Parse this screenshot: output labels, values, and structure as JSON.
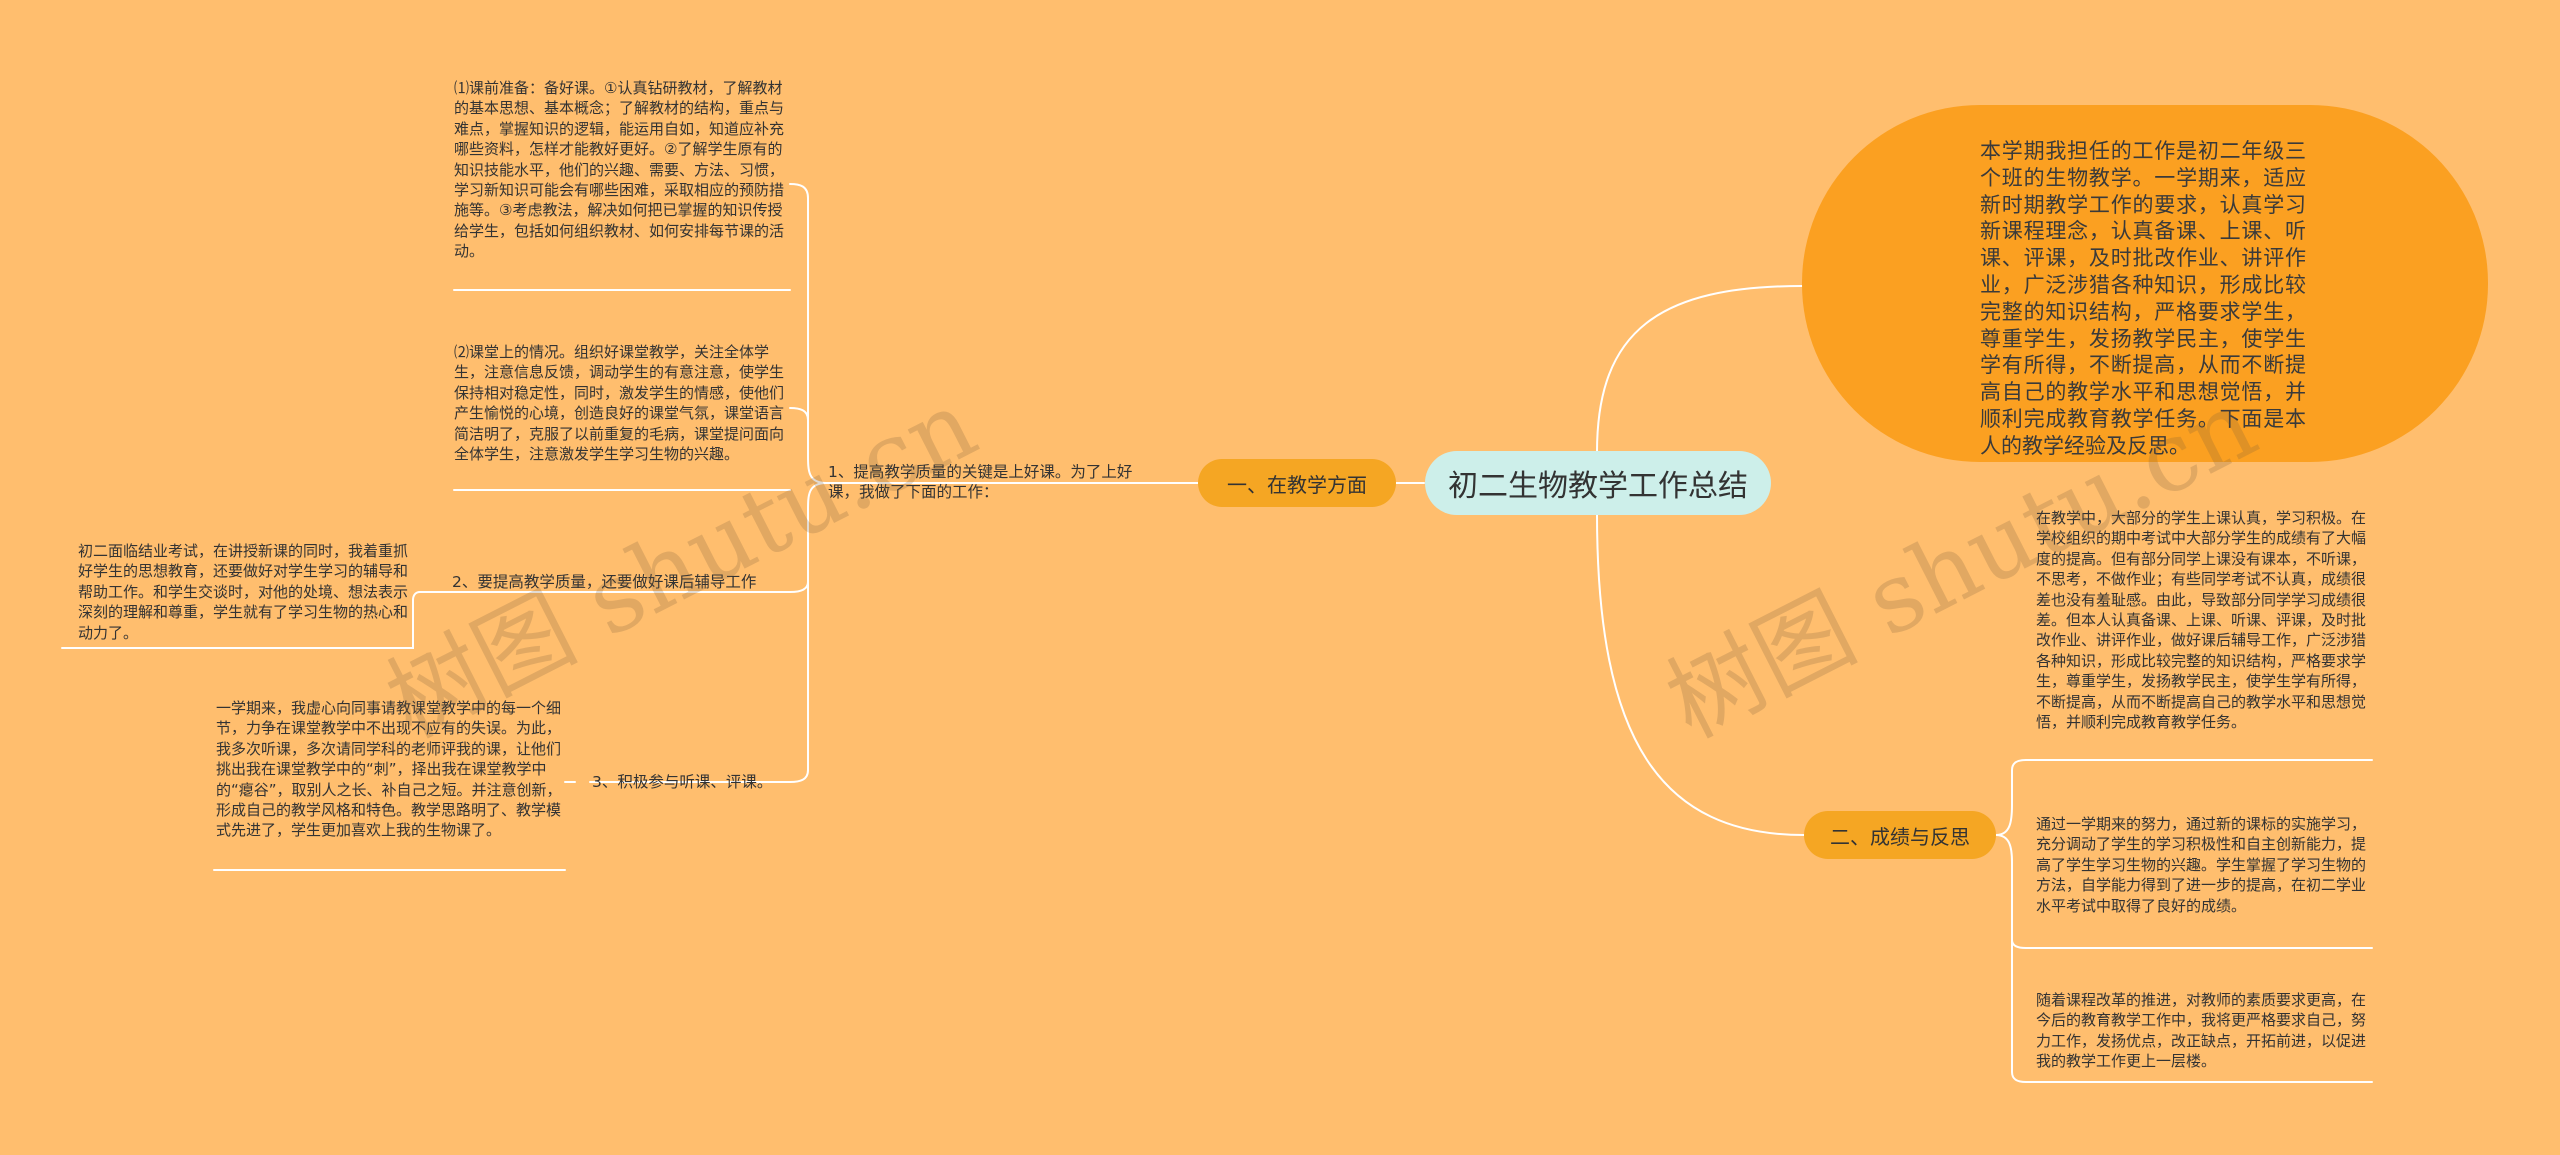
{
  "root": {
    "label": "初二生物教学工作总结"
  },
  "intro": "本学期我担任的工作是初二年级三个班的生物教学。一学期来，适应新时期教学工作的要求，认真学习新课程理念，认真备课、上课、听课、评课，及时批改作业、讲评作业，广泛涉猎各种知识，形成比较完整的知识结构，严格要求学生，尊重学生，发扬教学民主，使学生学有所得，不断提高，从而不断提高自己的教学水平和思想觉悟，并顺利完成教育教学任务。下面是本人的教学经验及反思。",
  "branch1": {
    "label": "一、在教学方面",
    "child": {
      "text": "1、提高教学质量的关键是上好课。为了上好课，我做了下面的工作：",
      "items": [
        {
          "text": "⑴课前准备：备好课。①认真钻研教材，了解教材的基本思想、基本概念；了解教材的结构，重点与难点，掌握知识的逻辑，能运用自如，知道应补充哪些资料，怎样才能教好更好。②了解学生原有的知识技能水平，他们的兴趣、需要、方法、习惯，学习新知识可能会有哪些困难，采取相应的预防措施等。③考虑教法，解决如何把已掌握的知识传授给学生，包括如何组织教材、如何安排每节课的活动。"
        },
        {
          "text": "⑵课堂上的情况。组织好课堂教学，关注全体学生，注意信息反馈，调动学生的有意注意，使学生保持相对稳定性，同时，激发学生的情感，使他们产生愉悦的心境，创造良好的课堂气氛，课堂语言简洁明了，克服了以前重复的毛病，课堂提问面向全体学生，注意激发学生学习生物的兴趣。"
        },
        {
          "text": "2、要提高教学质量，还要做好课后辅导工作",
          "detail": "初二面临结业考试，在讲授新课的同时，我着重抓好学生的思想教育，还要做好对学生学习的辅导和帮助工作。和学生交谈时，对他的处境、想法表示深刻的理解和尊重，学生就有了学习生物的热心和动力了。"
        },
        {
          "text": "3、积极参与听课、评课。",
          "detail": "一学期来，我虚心向同事请教课堂教学中的每一个细节，力争在课堂教学中不出现不应有的失误。为此，我多次听课，多次请同学科的老师评我的课，让他们挑出我在课堂教学中的“刺”，择出我在课堂教学中的“瘪谷”，取别人之长、补自己之短。并注意创新，形成自己的教学风格和特色。教学思路明了、教学模式先进了，学生更加喜欢上我的生物课了。"
        }
      ]
    }
  },
  "branch2": {
    "label": "二、成绩与反思",
    "items": [
      {
        "text": "在教学中，大部分的学生上课认真，学习积极。在学校组织的期中考试中大部分学生的成绩有了大幅度的提高。但有部分同学上课没有课本，不听课，不思考，不做作业；有些同学考试不认真，成绩很差也没有羞耻感。由此，导致部分同学学习成绩很差。但本人认真备课、上课、听课、评课，及时批改作业、讲评作业，做好课后辅导工作，广泛涉猎各种知识，形成比较完整的知识结构，严格要求学生，尊重学生，发扬教学民主，使学生学有所得，不断提高，从而不断提高自己的教学水平和思想觉悟，并顺利完成教育教学任务。"
      },
      {
        "text": "通过一学期来的努力，通过新的课标的实施学习，充分调动了学生的学习积极性和自主创新能力，提高了学生学习生物的兴趣。学生掌握了学习生物的方法，自学能力得到了进一步的提高，在初二学业水平考试中取得了良好的成绩。"
      },
      {
        "text": "随着课程改革的推进，对教师的素质要求更高，在今后的教育教学工作中，我将更严格要求自己，努力工作，发扬优点，改正缺点，开拓前进，以促进我的教学工作更上一层楼。"
      }
    ]
  },
  "watermark": "树图 shutu.cn",
  "colors": {
    "background": "#FFBE6E",
    "branch": "#F5A623",
    "root": "#CDEFEA",
    "bubble": "#FBA021",
    "line": "#FFFFFF"
  }
}
